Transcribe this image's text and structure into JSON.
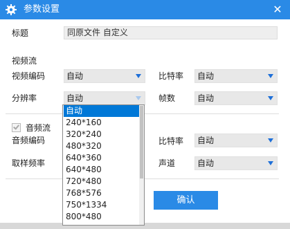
{
  "window": {
    "title": "参数设置",
    "close_glyph": "✕",
    "accent": "#2a8ae6"
  },
  "form": {
    "title_label": "标题",
    "title_value": "同原文件 自定义",
    "video_section": "视频流",
    "video_codec_label": "视频编码",
    "video_codec_value": "自动",
    "video_bitrate_label": "比特率",
    "video_bitrate_value": "自动",
    "resolution_label": "分辨率",
    "resolution_value": "自动",
    "framerate_label": "帧数",
    "framerate_value": "自动",
    "audio_section": "音频流",
    "audio_checked": true,
    "audio_codec_label": "音频编码",
    "audio_bitrate_label": "比特率",
    "audio_bitrate_value": "自动",
    "samplerate_label": "取样频率",
    "channel_label": "声道",
    "channel_value": "自动",
    "confirm_label": "确认"
  },
  "dropdown": {
    "selected_index": 0,
    "options": [
      "自动",
      "240*160",
      "320*240",
      "480*320",
      "640*360",
      "640*480",
      "720*480",
      "768*576",
      "750*1334",
      "800*480"
    ]
  }
}
